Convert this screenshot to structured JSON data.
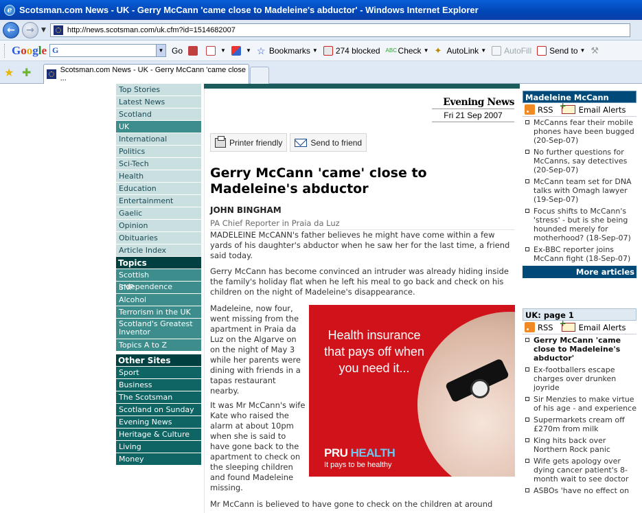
{
  "window": {
    "title": "Scotsman.com News - UK - Gerry McCann 'came close to Madeleine's abductor' - Windows Internet Explorer"
  },
  "address": {
    "url": "http://news.scotsman.com/uk.cfm?id=1514682007"
  },
  "toolbar": {
    "google_logo": "Google",
    "search_value": "G",
    "go": "Go",
    "bookmarks": "Bookmarks",
    "blocked": "274 blocked",
    "check": "Check",
    "autolink": "AutoLink",
    "autofill": "AutoFill",
    "sendto": "Send to"
  },
  "tab": {
    "title": "Scotsman.com News - UK - Gerry McCann 'came close ..."
  },
  "nav": {
    "sections": [
      "Top Stories",
      "Latest News",
      "Scotland",
      "UK",
      "International",
      "Politics",
      "Sci-Tech",
      "Health",
      "Education",
      "Entertainment",
      "Gaelic",
      "Opinion",
      "Obituaries",
      "Article Index"
    ],
    "active": "UK",
    "topics_heading": "Topics",
    "topics": [
      "Scottish independence",
      "SNP",
      "Alcohol",
      "Terrorism in the UK",
      "Scotland's Greatest Inventor",
      "Topics A to Z"
    ],
    "other_heading": "Other Sites",
    "other": [
      "Sport",
      "Business",
      "The Scotsman",
      "Scotland on Sunday",
      "Evening News",
      "Heritage & Culture",
      "Living",
      "Money"
    ]
  },
  "article": {
    "masthead": "Evening News",
    "date": "Fri 21 Sep 2007",
    "printer": "Printer friendly",
    "send": "Send to friend",
    "headline": "Gerry McCann 'came' close to Madeleine's abductor",
    "author": "JOHN BINGHAM",
    "role": "PA Chief Reporter in Praia da Luz",
    "p1": "MADELEINE McCANN's father believes he might have come within a few yards of his daughter's abductor when he saw her for the last time, a friend said today.",
    "p2": "Gerry McCann has become convinced an intruder was already hiding inside the family's holiday flat when he left his meal to go back and check on his children on the night of Madeleine's disappearance.",
    "p3": "Madeleine, now four, went missing from the apartment in Praia da Luz on the Algarve on on the night of May 3 while her parents were dining with friends in a tapas restaurant nearby.",
    "p4": "It was Mr McCann's wife Kate who raised the alarm at about 10pm when she is said to have gone back to the apartment to check on the sleeping children and found Madeleine missing.",
    "p5": "Mr McCann is believed to have gone to check on the children at around"
  },
  "ad": {
    "text": "Health insurance that pays off when you need it...",
    "brand_a": "PRU",
    "brand_b": "HEALTH",
    "tagline": "It pays to be healthy"
  },
  "madeleine_box": {
    "title": "Madeleine McCann",
    "rss": "RSS",
    "alerts": "Email Alerts",
    "items": [
      "McCanns fear their mobile phones have been bugged (20-Sep-07)",
      "No further questions for McCanns, say detectives (20-Sep-07)",
      "McCann team set for DNA talks with Omagh lawyer (19-Sep-07)",
      "Focus shifts to McCann's 'stress' - but is she being hounded merely for motherhood? (18-Sep-07)",
      "Ex-BBC reporter joins McCann fight (18-Sep-07)"
    ],
    "more": "More articles"
  },
  "uk_box": {
    "title_bold": "UK:",
    "title_rest": " page 1",
    "rss": "RSS",
    "alerts": "Email Alerts",
    "items": [
      "Gerry McCann 'came close to Madeleine's abductor'",
      "Ex-footballers escape charges over drunken joyride",
      "Sir Menzies to make virtue of his age - and experience",
      "Supermarkets cream off £270m from milk",
      "King hits back over Northern Rock panic",
      "Wife gets apology over dying cancer patient's 8-month wait to see doctor",
      "ASBOs 'have no effect on"
    ]
  }
}
